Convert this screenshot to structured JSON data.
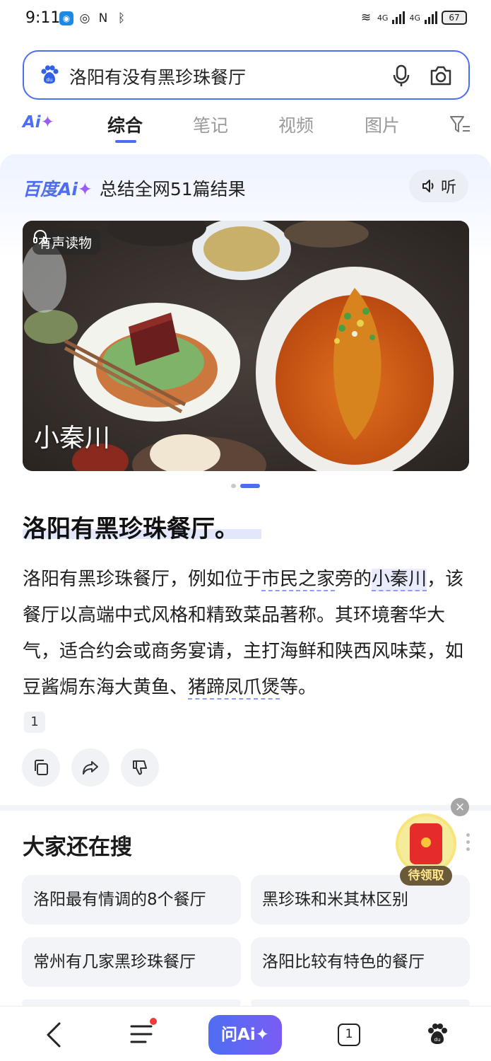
{
  "status_bar": {
    "time": "9:11",
    "network_labels": [
      "6",
      "4G",
      "4G"
    ],
    "battery": "67"
  },
  "search": {
    "query": "洛阳有没有黑珍珠餐厅",
    "icons": [
      "baidu-paw-icon",
      "microphone-icon",
      "camera-icon"
    ]
  },
  "tabs": {
    "ai_label": "Ai",
    "items": [
      "综合",
      "笔记",
      "视频",
      "图片"
    ],
    "active": "综合"
  },
  "ai_card": {
    "brand": "百度Ai",
    "summary": "总结全网51篇结果",
    "listen_label": "听",
    "image": {
      "badge": "有声读物",
      "caption": "小秦川"
    },
    "carousel": {
      "count": 2,
      "active_index": 1
    },
    "answer_title": "洛阳有黑珍珠餐厅。",
    "answer_segments": [
      "洛阳有黑珍珠餐厅，例如位于",
      "市民之家",
      "旁的",
      "小秦川",
      "，该餐厅以高端中式风格和精致菜品著称。其环境奢华大气，适合约会或商务宴请，主打海鲜和陕西风味菜，如豆酱焗东海大黄鱼、",
      "猪蹄凤爪煲",
      "等。"
    ],
    "citation": "1",
    "actions": [
      "copy-icon",
      "share-icon",
      "dislike-icon"
    ]
  },
  "related": {
    "title": "大家还在搜",
    "items": [
      "洛阳最有情调的8个餐厅",
      "黑珍珠和米其林区别",
      "常州有几家黑珍珠餐厅",
      "洛阳比较有特色的餐厅"
    ]
  },
  "float": {
    "redpack_label": "待领取",
    "close": "×"
  },
  "bottom_nav": {
    "ai_button": "问Ai",
    "tab_count": "1"
  },
  "colors": {
    "accent": "#4e6ef2",
    "accent_purple": "#9b5cf5",
    "red": "#e62b2b"
  }
}
